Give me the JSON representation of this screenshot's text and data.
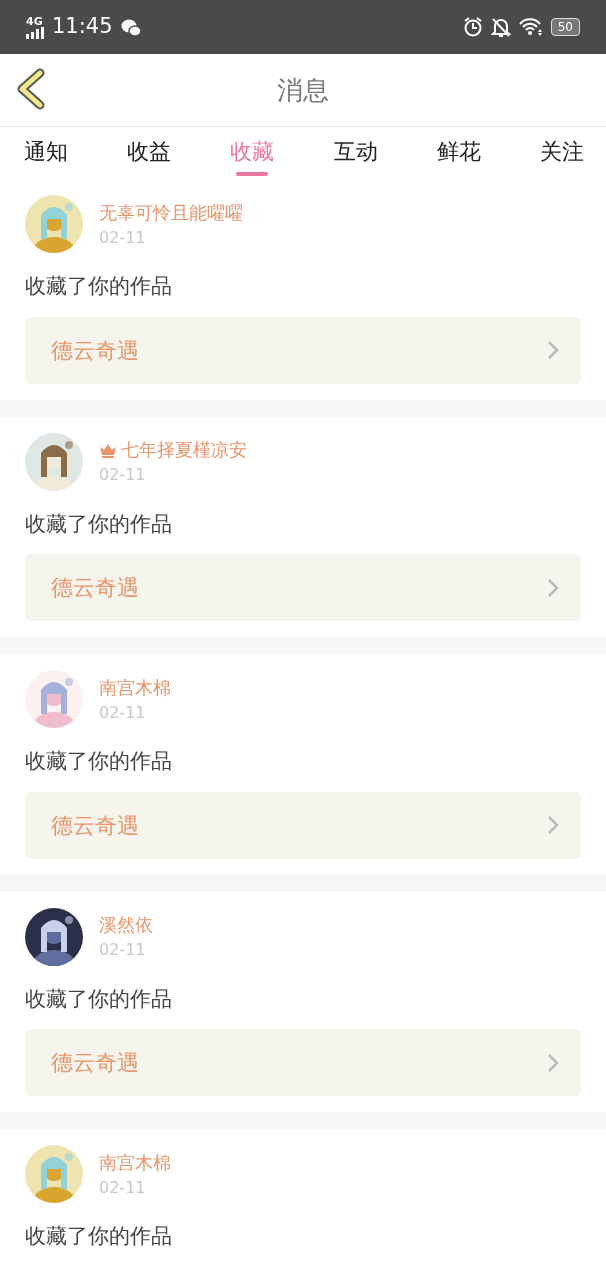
{
  "status_bar": {
    "network": "4G",
    "time": "11:45",
    "battery": "50"
  },
  "header": {
    "title": "消息"
  },
  "tabs": [
    {
      "label": "通知",
      "selected": false
    },
    {
      "label": "收益",
      "selected": false
    },
    {
      "label": "收藏",
      "selected": true
    },
    {
      "label": "互动",
      "selected": false
    },
    {
      "label": "鲜花",
      "selected": false
    },
    {
      "label": "关注",
      "selected": false
    }
  ],
  "messages": [
    {
      "user": "无辜可怜且能嚁嚁",
      "vip": false,
      "date": "02-11",
      "text": "收藏了你的作品",
      "work": "德云奇遇"
    },
    {
      "user": "七年择夏槿凉安",
      "vip": true,
      "date": "02-11",
      "text": "收藏了你的作品",
      "work": "德云奇遇"
    },
    {
      "user": "南宫木棉",
      "vip": false,
      "date": "02-11",
      "text": "收藏了你的作品",
      "work": "德云奇遇"
    },
    {
      "user": "溪然依",
      "vip": false,
      "date": "02-11",
      "text": "收藏了你的作品",
      "work": "德云奇遇"
    },
    {
      "user": "南宫木棉",
      "vip": false,
      "date": "02-11",
      "text": "收藏了你的作品"
    }
  ]
}
